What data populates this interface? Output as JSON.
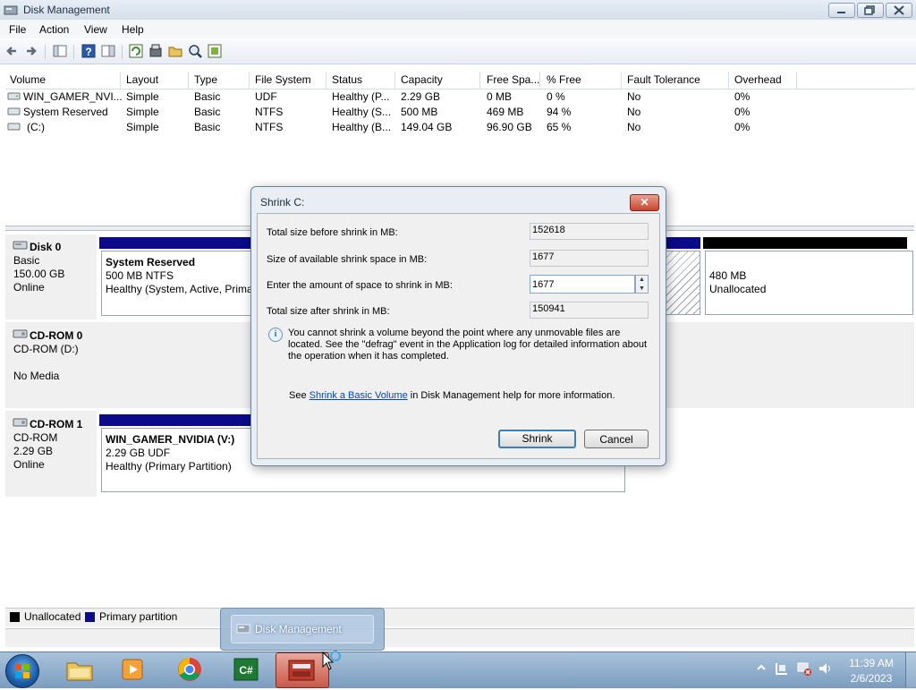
{
  "window": {
    "title": "Disk Management"
  },
  "menu": [
    "File",
    "Action",
    "View",
    "Help"
  ],
  "volume_table": {
    "headers": [
      "Volume",
      "Layout",
      "Type",
      "File System",
      "Status",
      "Capacity",
      "Free Spa...",
      "% Free",
      "Fault Tolerance",
      "Overhead"
    ],
    "rows": [
      [
        "WIN_GAMER_NVI...",
        "Simple",
        "Basic",
        "UDF",
        "Healthy (P...",
        "2.29 GB",
        "0 MB",
        "0 %",
        "No",
        "0%"
      ],
      [
        "System Reserved",
        "Simple",
        "Basic",
        "NTFS",
        "Healthy (S...",
        "500 MB",
        "469 MB",
        "94 %",
        "No",
        "0%"
      ],
      [
        "(C:)",
        "Simple",
        "Basic",
        "NTFS",
        "Healthy (B...",
        "149.04 GB",
        "96.90 GB",
        "65 %",
        "No",
        "0%"
      ]
    ]
  },
  "disks": {
    "disk0": {
      "name": "Disk 0",
      "type": "Basic",
      "size": "150.00 GB",
      "state": "Online",
      "part1": {
        "name": "System Reserved",
        "detail": "500 MB NTFS",
        "status": "Healthy (System, Active, Prima"
      },
      "part3": {
        "size": "480 MB",
        "status": "Unallocated"
      }
    },
    "cdrom0": {
      "name": "CD-ROM 0",
      "sub": "CD-ROM (D:)",
      "state": "No Media"
    },
    "cdrom1": {
      "name": "CD-ROM 1",
      "sub": "CD-ROM",
      "size": "2.29 GB",
      "state": "Online",
      "part1": {
        "name": "WIN_GAMER_NVIDIA  (V:)",
        "detail": "2.29 GB UDF",
        "status": "Healthy (Primary Partition)"
      }
    }
  },
  "legend": {
    "unallocated": "Unallocated",
    "primary": "Primary partition"
  },
  "dialog": {
    "title": "Shrink C:",
    "close": "✕",
    "total_before_label": "Total size before shrink in MB:",
    "total_before_value": "152618",
    "available_label": "Size of available shrink space in MB:",
    "available_value": "1677",
    "enter_label": "Enter the amount of space to shrink in MB:",
    "enter_value": "1677",
    "total_after_label": "Total size after shrink in MB:",
    "total_after_value": "150941",
    "info": "You cannot shrink a volume beyond the point where any unmovable files are located. See the \"defrag\" event in the Application log for detailed information about the operation when it has completed.",
    "help_prefix": "See ",
    "help_link": "Shrink a Basic Volume",
    "help_suffix": " in Disk Management help for more information.",
    "shrink_button": "Shrink",
    "cancel_button": "Cancel"
  },
  "taskbar": {
    "thumbnail_label": "Disk Management",
    "time": "11:39 AM",
    "date": "2/6/2023"
  },
  "colors": {
    "partition_blue": "#0a0a8a",
    "unallocated_black": "#000000"
  }
}
